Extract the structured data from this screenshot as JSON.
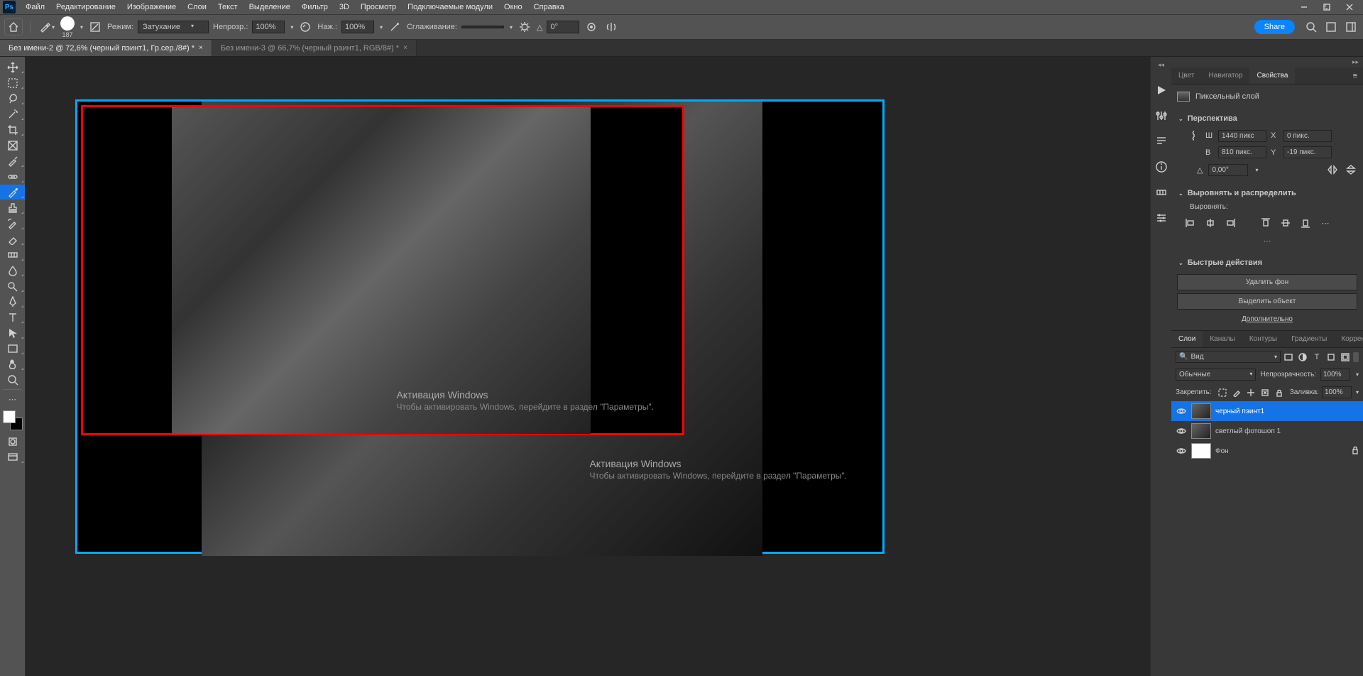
{
  "menubar": {
    "logo": "Ps",
    "items": [
      "Файл",
      "Редактирование",
      "Изображение",
      "Слои",
      "Текст",
      "Выделение",
      "Фильтр",
      "3D",
      "Просмотр",
      "Подключаемые модули",
      "Окно",
      "Справка"
    ]
  },
  "optionsbar": {
    "brush_size": "187",
    "mode_label": "Режим:",
    "mode_value": "Затухание",
    "opacity_label": "Непрозр.:",
    "opacity_value": "100%",
    "flow_label": "Наж.:",
    "flow_value": "100%",
    "smoothing_label": "Сглаживание:",
    "angle_icon": "△",
    "angle_value": "0°",
    "share_label": "Share"
  },
  "tabs": [
    {
      "title": "Без имени-2 @ 72,6% (черный пэинт1, Гр.сер./8#) *",
      "active": true
    },
    {
      "title": "Без имени-3 @ 66,7% (черный раинт1, RGB/8#) *",
      "active": false
    }
  ],
  "watermark": {
    "title": "Активация Windows",
    "sub": "Чтобы активировать Windows, перейдите в раздел \"Параметры\"."
  },
  "panels": {
    "top_tabs": [
      "Цвет",
      "Навигатор",
      "Свойства"
    ],
    "top_active": "Свойства",
    "properties": {
      "type_label": "Пиксельный слой",
      "transform_header": "Перспектива",
      "w_label": "Ш",
      "w_value": "1440 пикс",
      "h_label": "В",
      "h_value": "810 пикс.",
      "x_label": "X",
      "x_value": "0 пикс.",
      "y_label": "Y",
      "y_value": "-19 пикс.",
      "angle_label": "△",
      "angle_value": "0,00°",
      "align_header": "Выровнять и распределить",
      "align_sub": "Выровнять:",
      "quick_header": "Быстрые действия",
      "remove_bg": "Удалить фон",
      "select_subject": "Выделить объект",
      "more_link": "Дополнительно"
    },
    "layers": {
      "tabs": [
        "Слои",
        "Каналы",
        "Контуры",
        "Градиенты",
        "Коррекция"
      ],
      "active": "Слои",
      "filter_label": "Вид",
      "blend_mode": "Обычные",
      "opacity_label": "Непрозрачность:",
      "opacity_value": "100%",
      "lock_label": "Закрепить:",
      "fill_label": "Заливка:",
      "fill_value": "100%",
      "items": [
        {
          "name": "черный пэинт1",
          "selected": true,
          "thumb": "img"
        },
        {
          "name": "светлый фотошоп 1",
          "selected": false,
          "thumb": "img"
        },
        {
          "name": "Фон",
          "selected": false,
          "thumb": "white",
          "locked": true
        }
      ]
    }
  }
}
